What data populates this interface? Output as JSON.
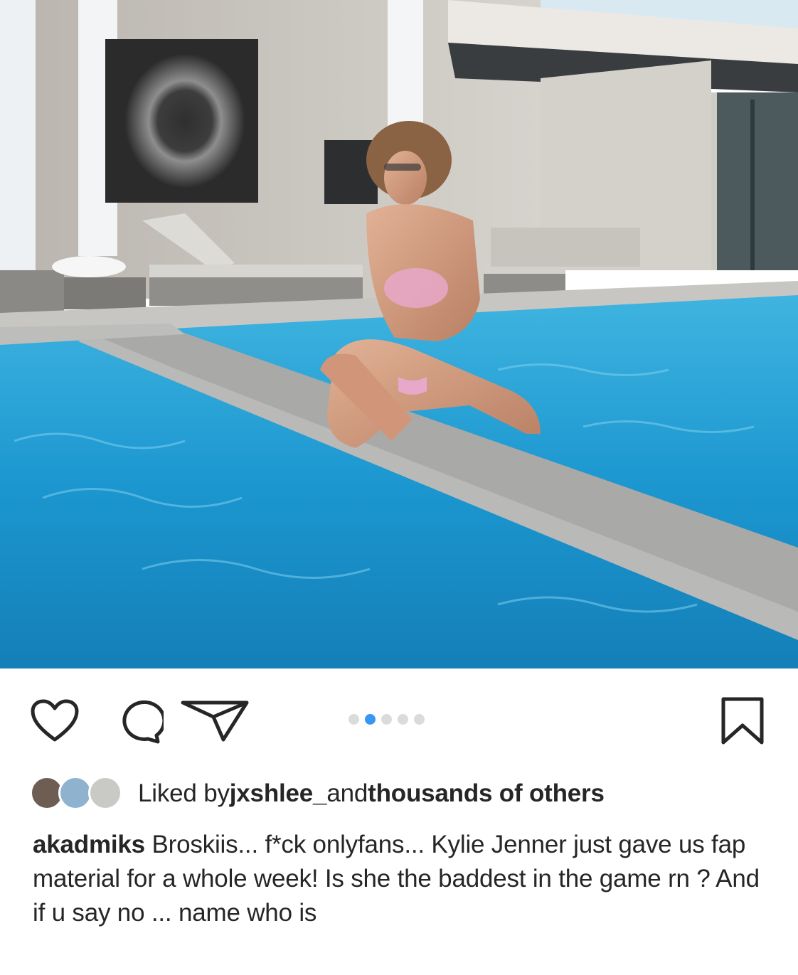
{
  "post": {
    "image": {
      "description_icon": "photo-pool-scene",
      "colors": {
        "sky": "#cfe6f4",
        "pool": "#1c9fd6",
        "wall": "#c9c6c0",
        "deck": "#a9a9a6"
      }
    },
    "carousel": {
      "total": 5,
      "active_index": 1
    },
    "actions": {
      "like_icon": "heart-icon",
      "comment_icon": "comment-icon",
      "share_icon": "direct-share-icon",
      "save_icon": "bookmark-icon"
    },
    "likes": {
      "prefix": "Liked by ",
      "user": "jxshlee_",
      "middle": " and ",
      "others": "thousands of others"
    },
    "caption": {
      "username": "akadmiks",
      "text": " Broskiis... f*ck onlyfans... Kylie Jenner just gave us fap material for a whole week! Is she the baddest in the game rn ? And if u say no ... name who is"
    },
    "accent_color": "#3897f0"
  }
}
